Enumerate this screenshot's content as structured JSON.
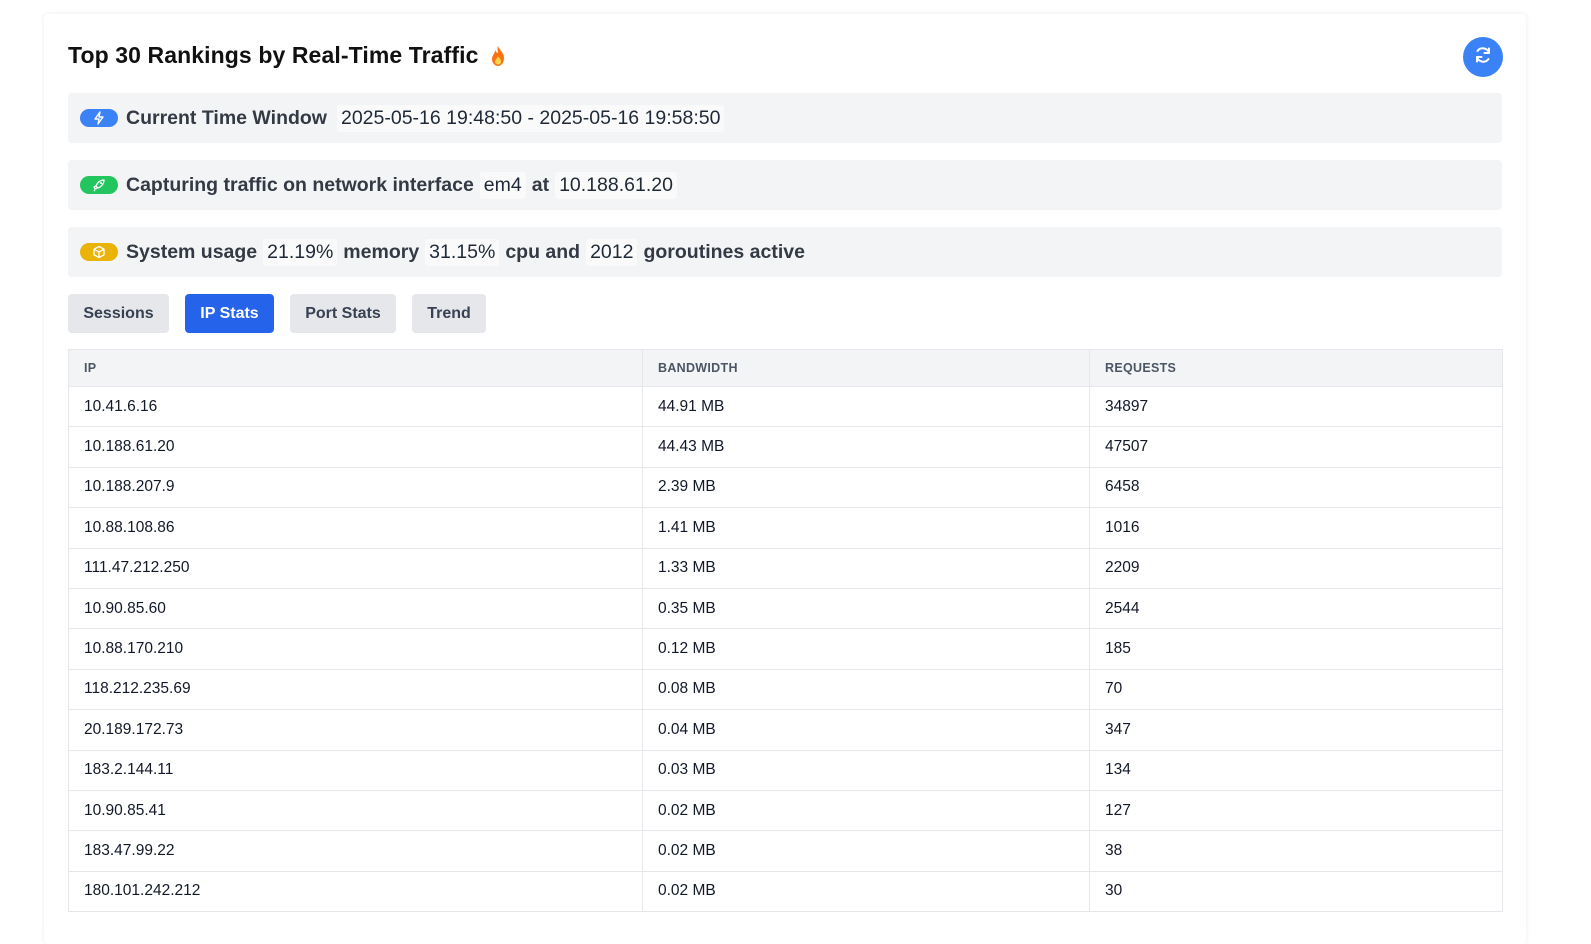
{
  "header": {
    "title": "Top 30 Rankings by Real-Time Traffic",
    "title_icon": "fire-icon",
    "refresh_icon": "refresh-icon"
  },
  "time_window": {
    "label": "Current Time Window",
    "value": "2025-05-16 19:48:50 - 2025-05-16 19:58:50",
    "icon": "lightning-icon"
  },
  "capture": {
    "label": "Capturing traffic on network interface",
    "interface": "em4",
    "at_label": "at",
    "ip": "10.188.61.20",
    "icon": "rocket-icon"
  },
  "system": {
    "label": "System usage",
    "memory_value": "21.19%",
    "memory_label": "memory",
    "cpu_value": "31.15%",
    "cpu_label": "cpu and",
    "goroutines_value": "2012",
    "goroutines_label": "goroutines active",
    "icon": "cube-icon"
  },
  "tabs": [
    {
      "label": "Sessions",
      "active": false
    },
    {
      "label": "IP Stats",
      "active": true
    },
    {
      "label": "Port Stats",
      "active": false
    },
    {
      "label": "Trend",
      "active": false
    }
  ],
  "table": {
    "columns": [
      "IP",
      "BANDWIDTH",
      "REQUESTS"
    ],
    "rows": [
      [
        "10.41.6.16",
        "44.91 MB",
        "34897"
      ],
      [
        "10.188.61.20",
        "44.43 MB",
        "47507"
      ],
      [
        "10.188.207.9",
        "2.39 MB",
        "6458"
      ],
      [
        "10.88.108.86",
        "1.41 MB",
        "1016"
      ],
      [
        "111.47.212.250",
        "1.33 MB",
        "2209"
      ],
      [
        "10.90.85.60",
        "0.35 MB",
        "2544"
      ],
      [
        "10.88.170.210",
        "0.12 MB",
        "185"
      ],
      [
        "118.212.235.69",
        "0.08 MB",
        "70"
      ],
      [
        "20.189.172.73",
        "0.04 MB",
        "347"
      ],
      [
        "183.2.144.11",
        "0.03 MB",
        "134"
      ],
      [
        "10.90.85.41",
        "0.02 MB",
        "127"
      ],
      [
        "183.47.99.22",
        "0.02 MB",
        "38"
      ],
      [
        "180.101.242.212",
        "0.02 MB",
        "30"
      ]
    ]
  },
  "colors": {
    "primary": "#2563eb",
    "refresh": "#3b82f6",
    "lightning_pill": "#3b82f6",
    "rocket_pill": "#22c55e",
    "cube_pill": "#eab308",
    "fire": "#f97316"
  }
}
